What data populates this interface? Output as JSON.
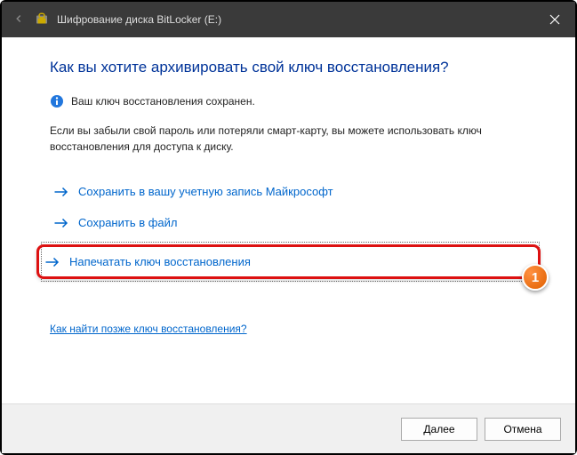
{
  "titlebar": {
    "title": "Шифрование диска BitLocker (E:)"
  },
  "heading": "Как вы хотите архивировать свой ключ восстановления?",
  "info_saved": "Ваш ключ восстановления сохранен.",
  "body": "Если вы забыли свой пароль или потеряли смарт-карту, вы можете использовать ключ восстановления для доступа к диску.",
  "options": {
    "save_ms": "Сохранить в вашу учетную запись Майкрософт",
    "save_file": "Сохранить в файл",
    "print": "Напечатать ключ восстановления"
  },
  "help_link": "Как найти позже ключ восстановления?",
  "buttons": {
    "next": "Далее",
    "cancel": "Отмена"
  },
  "callout": "1"
}
